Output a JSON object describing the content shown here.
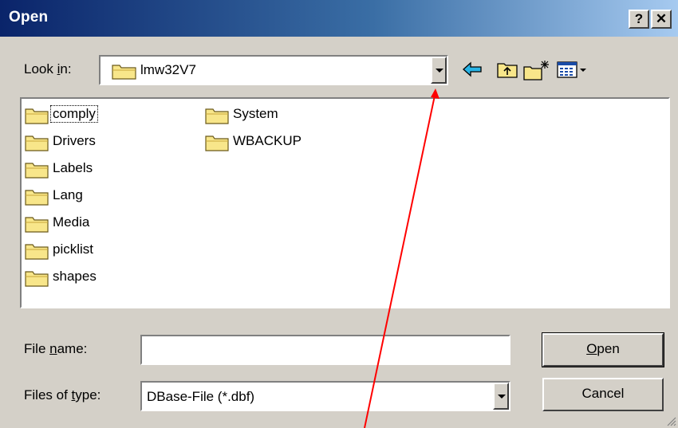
{
  "window": {
    "title": "Open",
    "help_glyph": "?",
    "close_glyph": "✕"
  },
  "lookin": {
    "label_prefix": "Look ",
    "label_underlined": "i",
    "label_suffix": "n:",
    "value": "lmw32V7",
    "icon": "folder-icon"
  },
  "toolbar": {
    "icons": [
      "back-arrow-icon",
      "up-folder-icon",
      "new-folder-icon",
      "view-menu-icon"
    ]
  },
  "files": {
    "column1": [
      "comply",
      "Drivers",
      "Labels",
      "Lang",
      "Media",
      "picklist",
      "shapes"
    ],
    "column2": [
      "System",
      "WBACKUP"
    ],
    "focused_item": "comply"
  },
  "filename": {
    "label_prefix": "File ",
    "label_underlined": "n",
    "label_suffix": "ame:",
    "value": ""
  },
  "filetype": {
    "label_prefix": "Files of ",
    "label_underlined": "t",
    "label_suffix": "ype:",
    "value": "DBase-File (*.dbf)"
  },
  "buttons": {
    "open_underlined": "O",
    "open_suffix": "pen",
    "cancel": "Cancel"
  },
  "colors": {
    "titlebar_start": "#0a246a",
    "titlebar_end": "#a6caf0",
    "dialog_bg": "#d4d0c8",
    "annotation_arrow": "#ff0000",
    "folder_fill": "#f8e68a"
  }
}
